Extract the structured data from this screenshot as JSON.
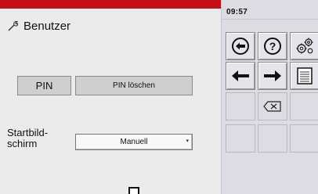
{
  "title": "Benutzer",
  "buttons": {
    "pin": "PIN",
    "pin_delete": "PIN löschen"
  },
  "start_screen": {
    "label": "Startbild-\nschirm",
    "value": "Manuell"
  },
  "status": {
    "time": "09:57"
  },
  "colors": {
    "header_bar": "#c30e16",
    "panel_bg": "#ebebeb",
    "keypad_bg": "#dcdce2"
  },
  "icons": {
    "title": "wrench-icon",
    "keys": [
      "back-circle-icon",
      "help-icon",
      "settings-gears-icon",
      "arrow-left-icon",
      "arrow-right-icon",
      "list-page-icon",
      "backspace-icon"
    ]
  }
}
